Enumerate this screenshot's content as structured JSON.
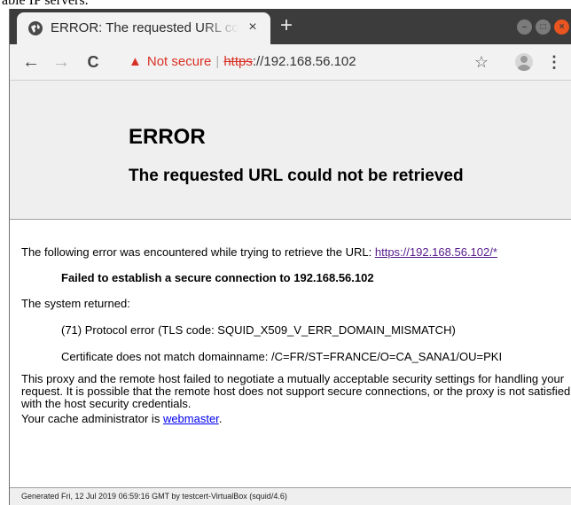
{
  "doc_fragment": "able IP servers.",
  "browser": {
    "tab": {
      "title": "ERROR: The requested URL could not be retrieved",
      "close_glyph": "×"
    },
    "new_tab_glyph": "+",
    "window_controls": {
      "minimize_glyph": "–",
      "maximize_glyph": "□",
      "close_glyph": "×"
    },
    "toolbar": {
      "back_glyph": "←",
      "forward_glyph": "→",
      "reload_glyph": "C",
      "security_label": "Not secure",
      "url_scheme": "https",
      "url_rest": "://192.168.56.102",
      "star_glyph": "☆",
      "menu_glyph": "⋮"
    },
    "colors": {
      "tabstrip": "#3c3c3c",
      "toolbar": "#f2f2f2",
      "warning_red": "#d93025",
      "ubuntu_close": "#e95420"
    }
  },
  "page": {
    "heading": "ERROR",
    "subheading": "The requested URL could not be retrieved",
    "intro_text": "The following error was encountered while trying to retrieve the URL: ",
    "intro_link": "https://192.168.56.102/*",
    "failure": "Failed to establish a secure connection to 192.168.56.102",
    "system_returned": "The system returned:",
    "protocol_error": "(71) Protocol error (TLS code: SQUID_X509_V_ERR_DOMAIN_MISMATCH)",
    "certificate": "Certificate does not match domainname: /C=FR/ST=FRANCE/O=CA_SANA1/OU=PKI",
    "explanation": "This proxy and the remote host failed to negotiate a mutually acceptable security settings for handling your request. It is possible that the remote host does not support secure connections, or the proxy is not satisfied with the host security credentials.",
    "admin_text": "Your cache administrator is ",
    "admin_link": "webmaster",
    "admin_suffix": ".",
    "footer": "Generated Fri, 12 Jul 2019 06:59:16 GMT by testcert-VirtualBox (squid/4.6)"
  }
}
